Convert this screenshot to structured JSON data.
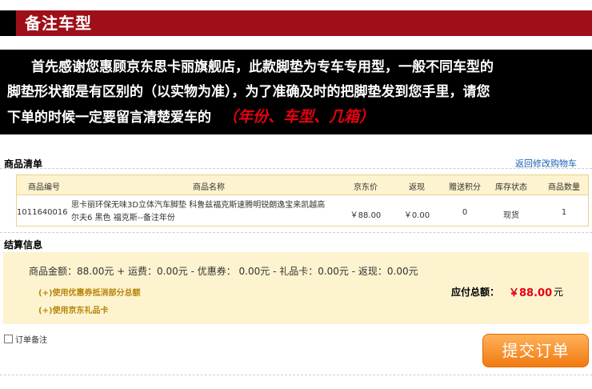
{
  "header": {
    "title": "备注车型"
  },
  "notice": {
    "line1": "首先感谢您惠顾京东思卡丽旗舰店，此款脚垫为专车专用型，一般不同车型的",
    "line2": "脚垫形状都是有区别的（以实物为准），为了准确及时的把脚垫发到您手里，请您",
    "line3": "下单的时候一定要留言清楚爱车的",
    "highlight": "（年份、车型、几箱）"
  },
  "goods": {
    "section_title": "商品清单",
    "back_link": "返回修改购物车",
    "columns": [
      "商品编号",
      "商品名称",
      "京东价",
      "返现",
      "赠送积分",
      "库存状态",
      "商品数量"
    ],
    "rows": [
      {
        "id": "1011640016",
        "name_line1": "思卡丽环保无味3D立体汽车脚垫 科鲁兹福克斯速腾明锐朗逸宝来凯越高",
        "name_line2": "尔夫6 黑色 福克斯--备注年份",
        "price": "￥88.00",
        "cashback": "￥0.00",
        "points": "0",
        "stock": "现货",
        "qty": "1"
      }
    ]
  },
  "settlement": {
    "section_title": "结算信息",
    "totals_line": "商品金额：88.00元 + 运费：0.00元 - 优惠券： 0.00元 - 礼品卡：0.00元 - 返现：0.00元",
    "coupon_option": "(+)使用优惠券抵消部分总额",
    "giftcard_option": "(+)使用京东礼品卡",
    "pay_label": "应付总额：",
    "pay_amount": "￥88.00",
    "pay_unit": "元"
  },
  "order": {
    "remark_label": "订单备注",
    "submit_label": "提交订单"
  },
  "colors": {
    "brand_red": "#9e0f1a",
    "price_red": "#e60012",
    "link_blue": "#1a5fb4",
    "button_orange": "#f07a10"
  }
}
